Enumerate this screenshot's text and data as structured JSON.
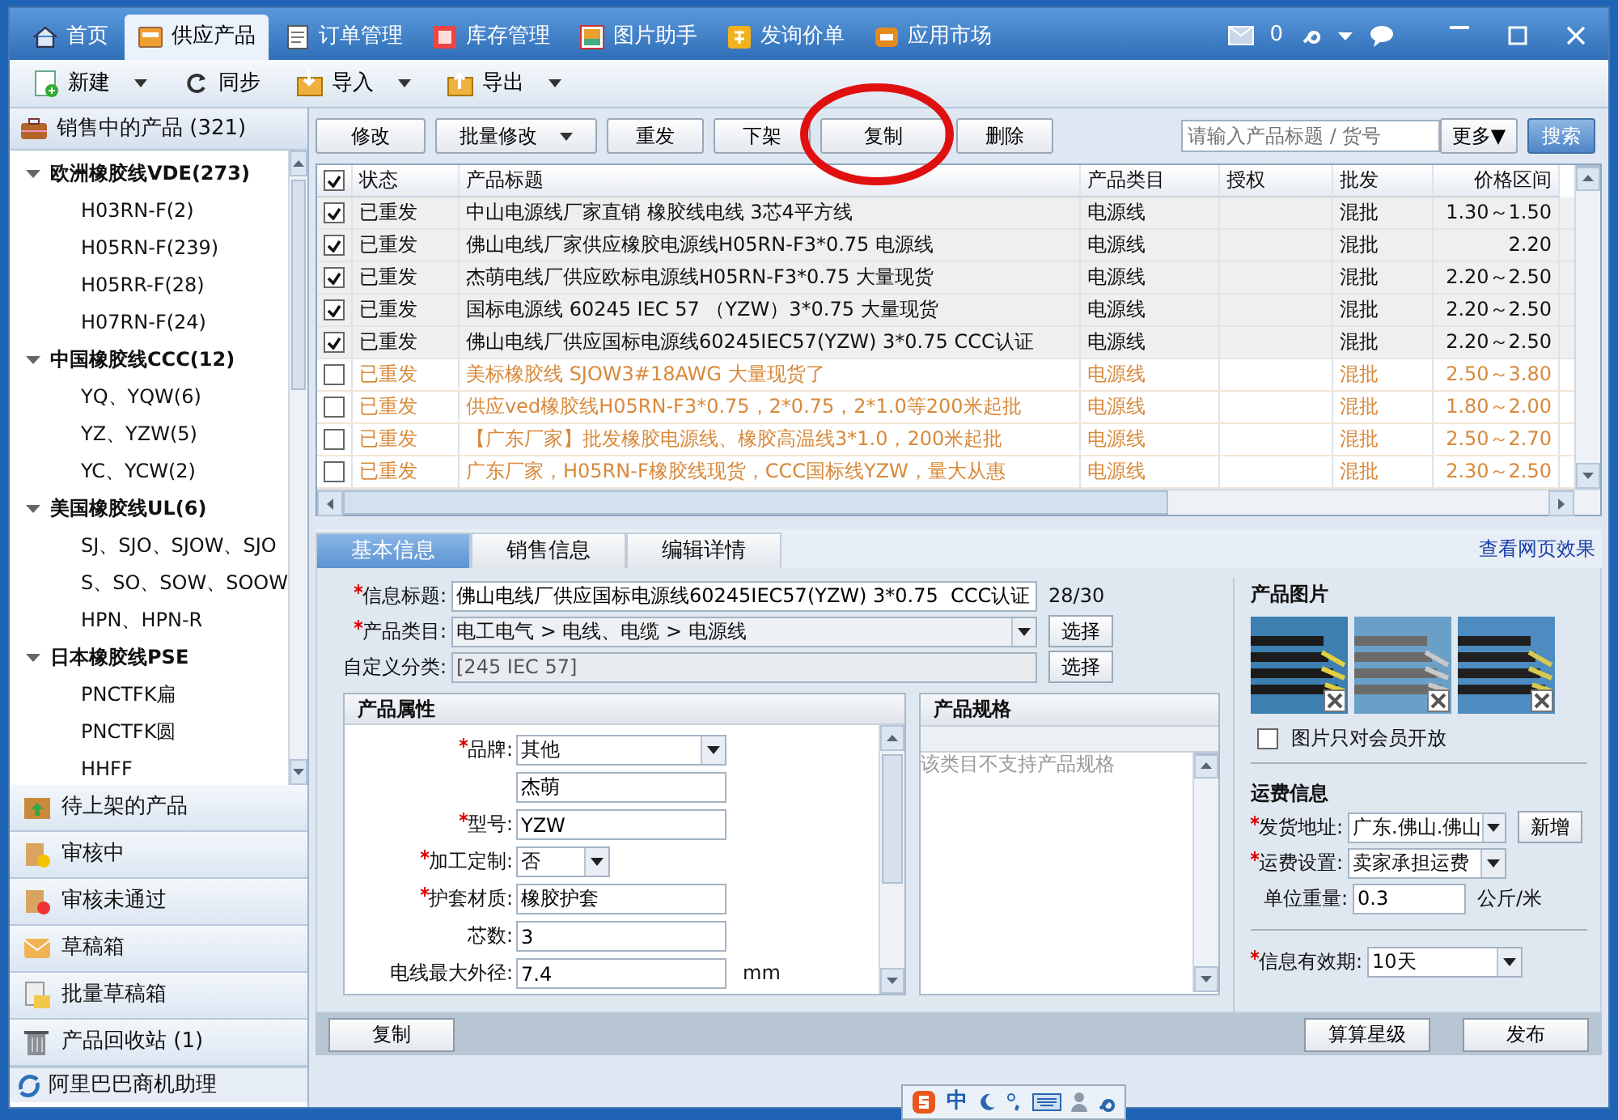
{
  "top_tabs": [
    {
      "label": "首页",
      "selected": false
    },
    {
      "label": "供应产品",
      "selected": true
    },
    {
      "label": "订单管理",
      "selected": false
    },
    {
      "label": "库存管理",
      "selected": false
    },
    {
      "label": "图片助手",
      "selected": false
    },
    {
      "label": "发询价单",
      "selected": false
    },
    {
      "label": "应用市场",
      "selected": false
    }
  ],
  "mail_count": "0",
  "toolbar": [
    {
      "label": "新建",
      "dropdown": true
    },
    {
      "label": "同步",
      "dropdown": false
    },
    {
      "label": "导入",
      "dropdown": true
    },
    {
      "label": "导出",
      "dropdown": true
    }
  ],
  "sidebar": {
    "header": "销售中的产品 (321)",
    "tree": [
      {
        "label": "欧洲橡胶线VDE(273)",
        "expanded": true,
        "children": [
          {
            "label": "H03RN-F(2)"
          },
          {
            "label": "H05RN-F(239)"
          },
          {
            "label": "H05RR-F(28)"
          },
          {
            "label": "H07RN-F(24)"
          }
        ]
      },
      {
        "label": "中国橡胶线CCC(12)",
        "expanded": true,
        "children": [
          {
            "label": "YQ、YQW(6)"
          },
          {
            "label": "YZ、YZW(5)"
          },
          {
            "label": "YC、YCW(2)"
          }
        ]
      },
      {
        "label": "美国橡胶线UL(6)",
        "expanded": true,
        "children": [
          {
            "label": "SJ、SJO、SJOW、SJO"
          },
          {
            "label": "S、SO、SOW、SOOW"
          },
          {
            "label": "HPN、HPN-R"
          }
        ]
      },
      {
        "label": "日本橡胶线PSE",
        "expanded": true,
        "children": [
          {
            "label": "PNCTFK扁"
          },
          {
            "label": "PNCTFK圆"
          },
          {
            "label": "HHFF"
          }
        ]
      }
    ],
    "sections": [
      {
        "label": "待上架的产品"
      },
      {
        "label": "审核中"
      },
      {
        "label": "审核未通过"
      },
      {
        "label": "草稿箱"
      },
      {
        "label": "批量草稿箱"
      },
      {
        "label": "产品回收站 (1)"
      }
    ],
    "footer": "阿里巴巴商机助理"
  },
  "actions": [
    {
      "label": "修改",
      "dropdown": false
    },
    {
      "label": "批量修改",
      "dropdown": true
    },
    {
      "label": "重发",
      "dropdown": false
    },
    {
      "label": "下架",
      "dropdown": false
    },
    {
      "label": "复制",
      "dropdown": false
    },
    {
      "label": "删除",
      "dropdown": false
    }
  ],
  "search": {
    "placeholder": "请输入产品标题 / 货号",
    "more": "更多▼",
    "button": "搜索"
  },
  "table": {
    "header_checked": true,
    "columns": [
      "状态",
      "产品标题",
      "产品类目",
      "授权",
      "批发",
      "价格区间"
    ],
    "rows": [
      {
        "checked": true,
        "status": "已重发",
        "title": "中山电源线厂家直销 橡胶线电线 3芯4平方线",
        "category": "电源线",
        "wholesale": "混批",
        "price": "1.30～1.50"
      },
      {
        "checked": true,
        "status": "已重发",
        "title": "佛山电线厂家供应橡胶电源线H05RN-F3*0.75 电源线",
        "category": "电源线",
        "wholesale": "混批",
        "price": "2.20"
      },
      {
        "checked": true,
        "status": "已重发",
        "title": "杰萌电线厂供应欧标电源线H05RN-F3*0.75 大量现货",
        "category": "电源线",
        "wholesale": "混批",
        "price": "2.20～2.50"
      },
      {
        "checked": true,
        "status": "已重发",
        "title": "国标电源线 60245 IEC 57 （YZW）3*0.75 大量现货",
        "category": "电源线",
        "wholesale": "混批",
        "price": "2.20～2.50"
      },
      {
        "checked": true,
        "status": "已重发",
        "title": "佛山电线厂供应国标电源线60245IEC57(YZW) 3*0.75  CCC认证",
        "category": "电源线",
        "wholesale": "混批",
        "price": "2.20～2.50"
      },
      {
        "checked": false,
        "status": "已重发",
        "title": "美标橡胶线 SJOW3#18AWG 大量现货了",
        "category": "电源线",
        "wholesale": "混批",
        "price": "2.50～3.80"
      },
      {
        "checked": false,
        "status": "已重发",
        "title": "供应ved橡胶线H05RN-F3*0.75，2*0.75，2*1.0等200米起批",
        "category": "电源线",
        "wholesale": "混批",
        "price": "1.80～2.00"
      },
      {
        "checked": false,
        "status": "已重发",
        "title": "【广东厂家】批发橡胶电源线、橡胶高温线3*1.0，200米起批",
        "category": "电源线",
        "wholesale": "混批",
        "price": "2.50～2.70"
      },
      {
        "checked": false,
        "status": "已重发",
        "title": "广东厂家，H05RN-F橡胶线现货，CCC国标线YZW，量大从惠",
        "category": "电源线",
        "wholesale": "混批",
        "price": "2.30～2.50"
      }
    ]
  },
  "detail_tabs": [
    {
      "label": "基本信息",
      "selected": true
    },
    {
      "label": "销售信息",
      "selected": false
    },
    {
      "label": "编辑详情",
      "selected": false
    }
  ],
  "preview_link": "查看网页效果",
  "fields": [
    {
      "label": "信息标题:",
      "required": true,
      "kind": "input",
      "value": "佛山电线厂供应国标电源线60245IEC57(YZW) 3*0.75  CCC认证",
      "counter": "28/30"
    },
    {
      "label": "产品类目:",
      "required": true,
      "kind": "select",
      "value": "电工电气 > 电线、电缆 > 电源线",
      "button": "选择"
    },
    {
      "label": "自定义分类:",
      "required": false,
      "kind": "disabled",
      "value": "[245 IEC 57]",
      "button": "选择"
    }
  ],
  "properties": {
    "title": "产品属性",
    "rows": [
      {
        "label": "品牌:",
        "required": true,
        "kind": "select",
        "value": "其他"
      },
      {
        "required": false,
        "kind": "input",
        "value": "杰萌"
      },
      {
        "label": "型号:",
        "required": true,
        "kind": "input",
        "value": "YZW"
      },
      {
        "label": "加工定制:",
        "required": true,
        "kind": "small-select",
        "value": "否"
      },
      {
        "label": "护套材质:",
        "required": true,
        "kind": "input",
        "value": "橡胶护套"
      },
      {
        "label": "芯数:",
        "required": false,
        "kind": "input",
        "value": "3"
      },
      {
        "label": "电线最大外径:",
        "required": false,
        "kind": "input",
        "value": "7.4",
        "unit": "mm"
      }
    ]
  },
  "specs": {
    "title": "产品规格",
    "note": "该类目不支持产品规格"
  },
  "pictures": {
    "title": "产品图片",
    "members_only": {
      "label": "图片只对会员开放",
      "checked": false
    }
  },
  "shipping": {
    "title": "运费信息",
    "rows": [
      {
        "label": "发货地址:",
        "required": true,
        "kind": "select",
        "value": "广东.佛山.佛山",
        "button": "新增"
      },
      {
        "label": "运费设置:",
        "required": true,
        "kind": "select",
        "value": "卖家承担运费"
      },
      {
        "label": "单位重量:",
        "required": false,
        "kind": "input",
        "value": "0.3",
        "unit": "公斤/米"
      }
    ]
  },
  "validity": {
    "label": "信息有效期:",
    "required": true,
    "value": "10天"
  },
  "bottom_buttons": {
    "left": "复制",
    "right": [
      "算算星级",
      "发布"
    ]
  },
  "ime": {
    "mode": "中"
  }
}
